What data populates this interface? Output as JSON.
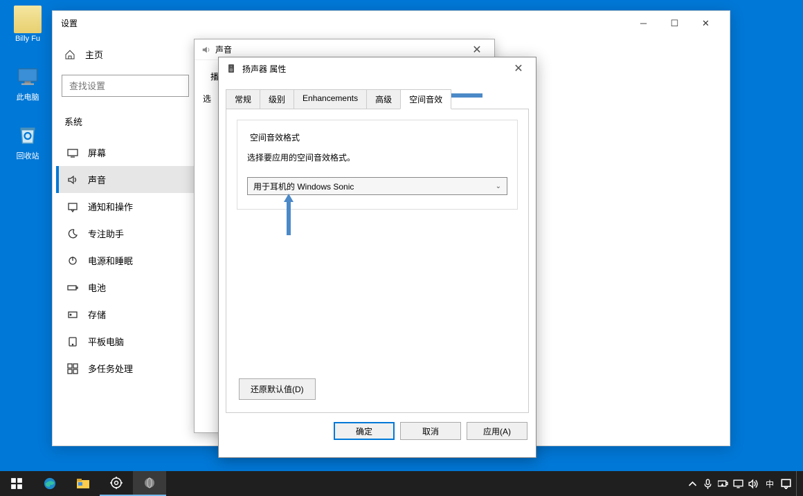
{
  "desktop": {
    "user": "Billy Fu",
    "pc": "此电脑",
    "recycle": "回收站"
  },
  "settings": {
    "title": "设置",
    "home": "主页",
    "search_placeholder": "查找设置",
    "system_header": "系统",
    "items": [
      "屏幕",
      "声音",
      "通知和操作",
      "专注助手",
      "电源和睡眠",
      "电池",
      "存储",
      "平板电脑",
      "多任务处理"
    ]
  },
  "sound_dialog": {
    "title": "声音",
    "tab_playback_prefix": "播放",
    "row_prefix": "选"
  },
  "speaker_dialog": {
    "title": "扬声器 属性",
    "tabs": [
      "常规",
      "级别",
      "Enhancements",
      "高级",
      "空间音效"
    ],
    "fieldset_title": "空间音效格式",
    "fieldset_desc": "选择要应用的空间音效格式。",
    "combo_value": "用于耳机的 Windows Sonic",
    "restore": "还原默认值(D)",
    "ok": "确定",
    "cancel": "取消",
    "apply": "应用(A)"
  },
  "tray": {
    "ime": "中"
  }
}
